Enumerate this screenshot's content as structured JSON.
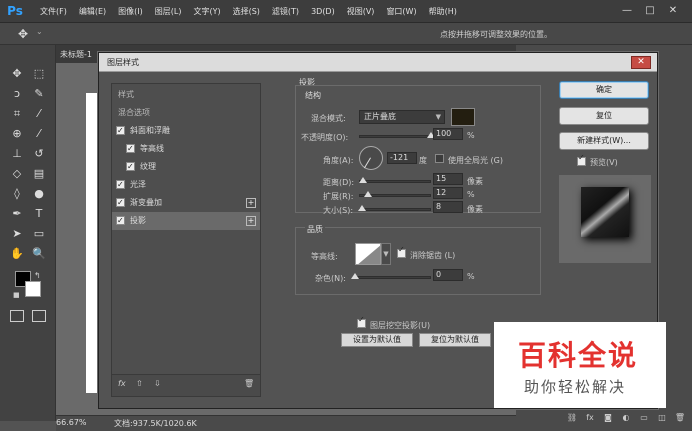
{
  "app": {
    "logo": "Ps",
    "menus": [
      "文件(F)",
      "编辑(E)",
      "图像(I)",
      "图层(L)",
      "文字(Y)",
      "选择(S)",
      "滤镜(T)",
      "3D(D)",
      "视图(V)",
      "窗口(W)",
      "帮助(H)"
    ],
    "window_controls": {
      "minimize": "—",
      "maximize": "□",
      "close": "✕"
    }
  },
  "options_bar": {
    "hint": "点按并拖移可调整效果的位置。"
  },
  "document": {
    "tab_title": "未标题-1",
    "zoom": "66.67%",
    "doc_size": "文档:937.5K/1020.6K"
  },
  "colors": {
    "accent": "#32a2ff",
    "shadow_color": "#231e10",
    "close_red": "#c64c44",
    "watermark_red": "#e3322f"
  },
  "dialog": {
    "title": "图层样式",
    "close": "✕",
    "styles_list": {
      "header": "样式",
      "blend_options": "混合选项",
      "items": [
        {
          "label": "斜面和浮雕",
          "checked": true,
          "indent": 0,
          "plus": false
        },
        {
          "label": "等高线",
          "checked": true,
          "indent": 1,
          "plus": false
        },
        {
          "label": "纹理",
          "checked": true,
          "indent": 1,
          "plus": false
        },
        {
          "label": "光泽",
          "checked": true,
          "indent": 0,
          "plus": false
        },
        {
          "label": "渐变叠加",
          "checked": true,
          "indent": 0,
          "plus": true
        },
        {
          "label": "投影",
          "checked": true,
          "indent": 0,
          "plus": true,
          "selected": true
        }
      ],
      "footer": {
        "fx": "fx",
        "up": "⇧",
        "down": "⇩",
        "trash": "🗑"
      }
    },
    "drop_shadow": {
      "section_title": "投影",
      "structure_title": "结构",
      "blend_mode_label": "混合模式:",
      "blend_mode_value": "正片叠底",
      "opacity_label": "不透明度(O):",
      "opacity_value": "100",
      "opacity_pct": 100,
      "percent": "%",
      "angle_label": "角度(A):",
      "angle_value": "-121",
      "angle_unit": "度",
      "global_light_label": "使用全局光 (G)",
      "distance_label": "距离(D):",
      "distance_value": "15",
      "distance_pct": 6,
      "spread_label": "扩展(R):",
      "spread_value": "12",
      "spread_pct": 12,
      "size_label": "大小(S):",
      "size_value": "8",
      "size_pct": 4,
      "pixels": "像素",
      "quality_title": "品质",
      "contour_label": "等高线:",
      "antialias_label": "消除锯齿 (L)",
      "noise_label": "杂色(N):",
      "noise_value": "0",
      "noise_pct": 0,
      "knockout_label": "图层挖空投影(U)",
      "set_default": "设置为默认值",
      "reset_default": "复位为默认值"
    },
    "buttons": {
      "ok": "确定",
      "reset": "复位",
      "new_style": "新建样式(W)...",
      "preview_label": "预览(V)"
    }
  },
  "watermark": {
    "title": "百科全说",
    "subtitle": "助你轻松解决"
  }
}
